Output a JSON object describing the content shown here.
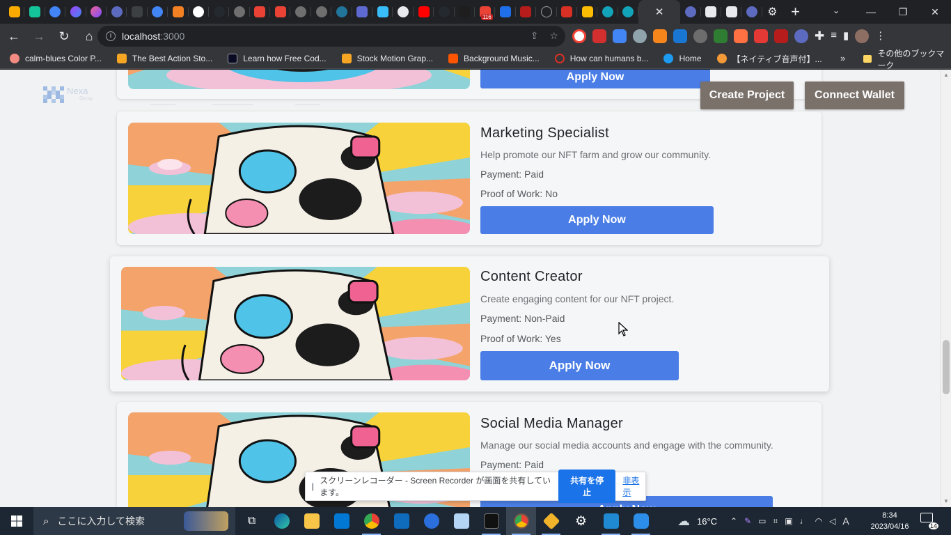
{
  "browser": {
    "tab_badge": "116",
    "url_host": "localhost",
    "url_port": ":3000",
    "bookmarks": [
      {
        "label": "calm-blues Color P...",
        "color": "#f28b82"
      },
      {
        "label": "The Best Action Sto...",
        "color": "#f6a623"
      },
      {
        "label": "Learn how Free Cod...",
        "color": "#1b1f23"
      },
      {
        "label": "Stock Motion Grap...",
        "color": "#f6a623"
      },
      {
        "label": "Background Music...",
        "color": "#ff5500"
      },
      {
        "label": "How can humans b...",
        "color": "#d93025"
      },
      {
        "label": "Home",
        "color": "#1d9bf0"
      },
      {
        "label": "【ネイティブ音声付】...",
        "color": "#f29a38"
      }
    ],
    "bookmarks_more": "»",
    "other_bookmarks": "その他のブックマーク"
  },
  "page": {
    "logo_text": "Nexa",
    "logo_sub": "Grow",
    "header_buttons": {
      "create": "Create Project",
      "connect": "Connect Wallet"
    },
    "top_apply": "Apply Now",
    "jobs": [
      {
        "title": "Marketing Specialist",
        "description": "Help promote our NFT farm and grow our community.",
        "payment": "Payment: Paid",
        "proof": "Proof of Work: No",
        "apply": "Apply Now"
      },
      {
        "title": "Content Creator",
        "description": "Create engaging content for our NFT project.",
        "payment": "Payment: Non-Paid",
        "proof": "Proof of Work: Yes",
        "apply": "Apply Now"
      },
      {
        "title": "Social Media Manager",
        "description": "Manage our social media accounts and engage with the community.",
        "payment": "Payment: Paid",
        "proof": "",
        "apply": "Apply Now"
      }
    ]
  },
  "recorder": {
    "message": "スクリーンレコーダー - Screen Recorder が画面を共有しています。",
    "stop": "共有を停止",
    "hide": "非表示"
  },
  "taskbar": {
    "search_placeholder": "ここに入力して検索",
    "weather": "16°C",
    "time": "8:34",
    "date": "2023/04/16",
    "notification_count": "14",
    "ime": "A"
  },
  "colors": {
    "accent_button": "#4a7ee6",
    "header_button": "#7a716b"
  }
}
